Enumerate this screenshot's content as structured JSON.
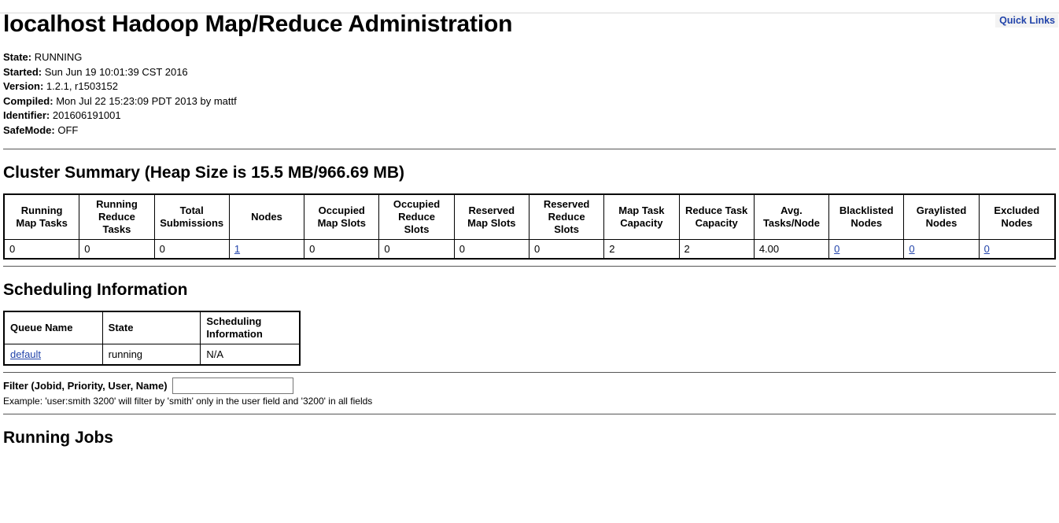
{
  "topbar": {
    "quick_links_label": "Quick Links"
  },
  "header": {
    "title": "localhost Hadoop Map/Reduce Administration"
  },
  "info": {
    "state_label": "State:",
    "state_value": "RUNNING",
    "started_label": "Started:",
    "started_value": "Sun Jun 19 10:01:39 CST 2016",
    "version_label": "Version:",
    "version_value": "1.2.1, r1503152",
    "compiled_label": "Compiled:",
    "compiled_value": "Mon Jul 22 15:23:09 PDT 2013 by mattf",
    "identifier_label": "Identifier:",
    "identifier_value": "201606191001",
    "safemode_label": "SafeMode:",
    "safemode_value": "OFF"
  },
  "cluster_summary": {
    "heading": "Cluster Summary (Heap Size is 15.5 MB/966.69 MB)",
    "columns": [
      "Running Map Tasks",
      "Running Reduce Tasks",
      "Total Submissions",
      "Nodes",
      "Occupied Map Slots",
      "Occupied Reduce Slots",
      "Reserved Map Slots",
      "Reserved Reduce Slots",
      "Map Task Capacity",
      "Reduce Task Capacity",
      "Avg. Tasks/Node",
      "Blacklisted Nodes",
      "Graylisted Nodes",
      "Excluded Nodes"
    ],
    "values": [
      "0",
      "0",
      "0",
      "1",
      "0",
      "0",
      "0",
      "0",
      "2",
      "2",
      "4.00",
      "0",
      "0",
      "0"
    ],
    "link_columns": [
      3,
      11,
      12,
      13
    ]
  },
  "scheduling": {
    "heading": "Scheduling Information",
    "columns": [
      "Queue Name",
      "State",
      "Scheduling Information"
    ],
    "rows": [
      {
        "queue_name": "default",
        "queue_name_is_link": true,
        "state": "running",
        "scheduling_information": "N/A"
      }
    ]
  },
  "filter": {
    "label": "Filter (Jobid, Priority, User, Name)",
    "value": "",
    "placeholder": "",
    "example": "Example: 'user:smith 3200' will filter by 'smith' only in the user field and '3200' in all fields"
  },
  "running_jobs": {
    "heading": "Running Jobs"
  },
  "colors": {
    "link": "#2244aa",
    "rule": "#555555",
    "border": "#000000",
    "quicklinks_bg": "#f3f3f3"
  }
}
